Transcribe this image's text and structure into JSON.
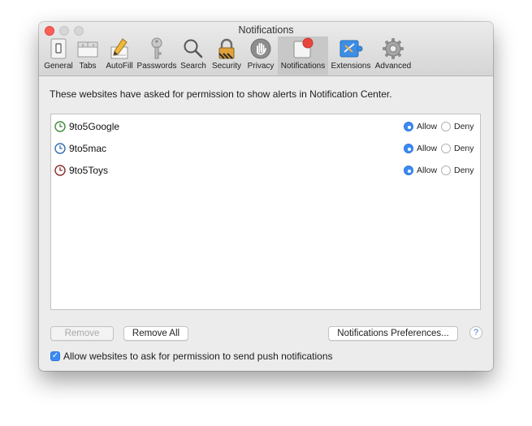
{
  "window": {
    "title": "Notifications"
  },
  "toolbar": {
    "tabs": [
      {
        "label": "General",
        "icon": "general-switch-icon"
      },
      {
        "label": "Tabs",
        "icon": "tabs-icon"
      },
      {
        "label": "AutoFill",
        "icon": "pencil-icon"
      },
      {
        "label": "Passwords",
        "icon": "key-icon"
      },
      {
        "label": "Search",
        "icon": "magnifier-icon"
      },
      {
        "label": "Security",
        "icon": "padlock-icon"
      },
      {
        "label": "Privacy",
        "icon": "hand-icon"
      },
      {
        "label": "Notifications",
        "icon": "notifications-icon",
        "active": true
      },
      {
        "label": "Extensions",
        "icon": "extensions-icon"
      },
      {
        "label": "Advanced",
        "icon": "gear-icon"
      }
    ]
  },
  "main": {
    "intro": "These websites have asked for permission to show alerts in Notification Center.",
    "sites": [
      {
        "name": "9to5Google",
        "allow_label": "Allow",
        "deny_label": "Deny",
        "selected": "Allow",
        "icon_color": "#3f8a3a"
      },
      {
        "name": "9to5mac",
        "allow_label": "Allow",
        "deny_label": "Deny",
        "selected": "Allow",
        "icon_color": "#2f6fb0"
      },
      {
        "name": "9to5Toys",
        "allow_label": "Allow",
        "deny_label": "Deny",
        "selected": "Allow",
        "icon_color": "#8a2a2a"
      }
    ],
    "remove_label": "Remove",
    "remove_all_label": "Remove All",
    "prefs_label": "Notifications Preferences...",
    "help_label": "?",
    "checkbox_label": "Allow websites to ask for permission to send push notifications",
    "checkbox_checked": true
  },
  "colors": {
    "accent": "#3b8af5",
    "close": "#fc5f57"
  }
}
